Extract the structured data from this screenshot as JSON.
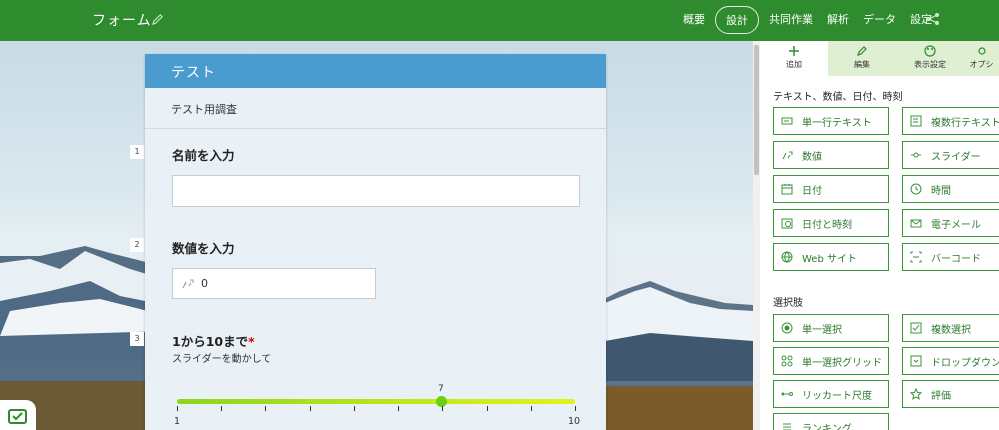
{
  "app": {
    "title": "フォーム"
  },
  "nav": {
    "items": [
      "概要",
      "設計",
      "共同作業",
      "解析",
      "データ",
      "設定"
    ],
    "active": "設計"
  },
  "form": {
    "title": "テスト",
    "description": "テスト用調査",
    "questions": [
      {
        "number": "1",
        "title": "名前を入力"
      },
      {
        "number": "2",
        "title": "数値を入力",
        "value": "0"
      },
      {
        "number": "3",
        "title": "1から10まで",
        "required_mark": "*",
        "subtitle": "スライダーを動かして",
        "slider": {
          "min": "1",
          "max": "10",
          "value": "7"
        }
      }
    ]
  },
  "panel": {
    "tabs": [
      {
        "label": "追加",
        "icon": "plus-icon"
      },
      {
        "label": "編集",
        "icon": "pencil-icon"
      },
      {
        "label": "表示設定",
        "icon": "palette-icon"
      },
      {
        "label": "オプシ",
        "icon": "gear-icon"
      }
    ],
    "section_text": "テキスト、数値、日付、時刻",
    "text_items": [
      {
        "label": "単一行テキスト",
        "icon": "single-line-icon"
      },
      {
        "label": "複数行テキスト",
        "icon": "multi-line-icon"
      },
      {
        "label": "数値",
        "icon": "number-icon"
      },
      {
        "label": "スライダー",
        "icon": "slider-icon"
      },
      {
        "label": "日付",
        "icon": "calendar-icon"
      },
      {
        "label": "時間",
        "icon": "clock-icon"
      },
      {
        "label": "日付と時刻",
        "icon": "datetime-icon"
      },
      {
        "label": "電子メール",
        "icon": "email-icon"
      },
      {
        "label": "Web サイト",
        "icon": "globe-icon"
      },
      {
        "label": "バーコード",
        "icon": "barcode-icon"
      }
    ],
    "section_choice": "選択肢",
    "choice_items": [
      {
        "label": "単一選択",
        "icon": "radio-icon"
      },
      {
        "label": "複数選択",
        "icon": "checkbox-icon"
      },
      {
        "label": "単一選択グリッド",
        "icon": "grid-icon"
      },
      {
        "label": "ドロップダウン",
        "icon": "dropdown-icon"
      },
      {
        "label": "リッカート尺度",
        "icon": "likert-icon"
      },
      {
        "label": "評価",
        "icon": "star-icon"
      },
      {
        "label": "ランキング",
        "icon": "ranking-icon"
      }
    ]
  },
  "colors": {
    "brand": "#2e8b2e",
    "form_header": "#4a9ccf",
    "button_border": "#3a943a"
  }
}
